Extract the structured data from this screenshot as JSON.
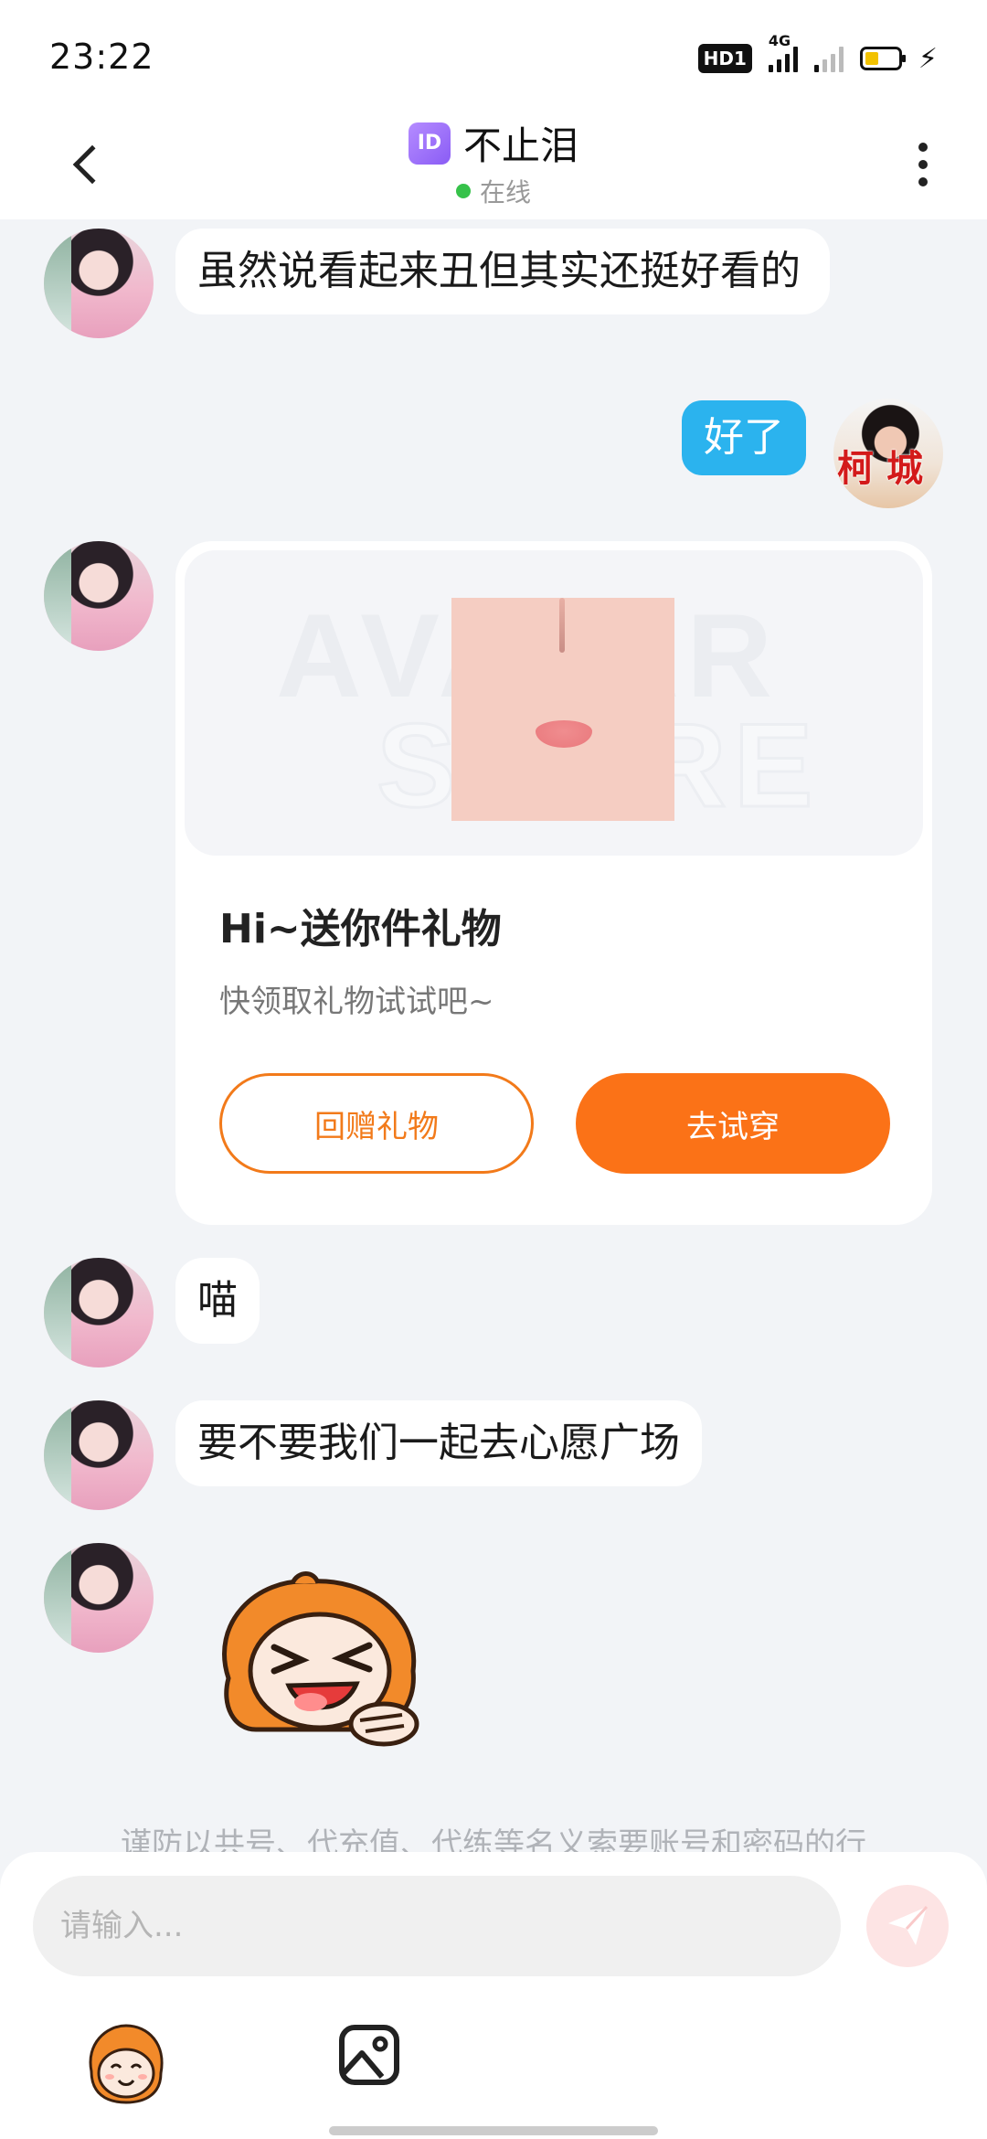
{
  "status_bar": {
    "time": "23:22",
    "hd_label": "HD1",
    "network_label": "4G"
  },
  "header": {
    "id_badge": "ID",
    "title": "不止泪",
    "status": "在线",
    "status_color": "#36c24a"
  },
  "messages": [
    {
      "sender": "other",
      "type": "text",
      "text": "虽然说看起来丑但其实还挺好看的"
    },
    {
      "sender": "self",
      "type": "text",
      "text": "好了",
      "avatar_stamp": "柯城"
    },
    {
      "sender": "other",
      "type": "gift_card"
    },
    {
      "sender": "other",
      "type": "text",
      "text": "喵"
    },
    {
      "sender": "other",
      "type": "text",
      "text": "要不要我们一起去心愿广场"
    },
    {
      "sender": "other",
      "type": "sticker",
      "icon": "laughing-mascot-sticker"
    }
  ],
  "gift_card": {
    "watermark_top": "AVATAR",
    "watermark_bottom": "STORE",
    "title": "Hi~送你件礼物",
    "subtitle": "快领取礼物试试吧~",
    "return_button": "回赠礼物",
    "try_button": "去试穿",
    "accent_color": "#fb7217"
  },
  "notice": "谨防以共号、代充值、代练等名义索要账号和密码的行",
  "composer": {
    "placeholder": "请输入...",
    "send_icon": "paper-plane-icon",
    "emoji_icon": "mascot-emoji-icon",
    "image_icon": "image-icon"
  },
  "colors": {
    "self_bubble": "#2bb3ee",
    "background": "#f2f4f7"
  }
}
